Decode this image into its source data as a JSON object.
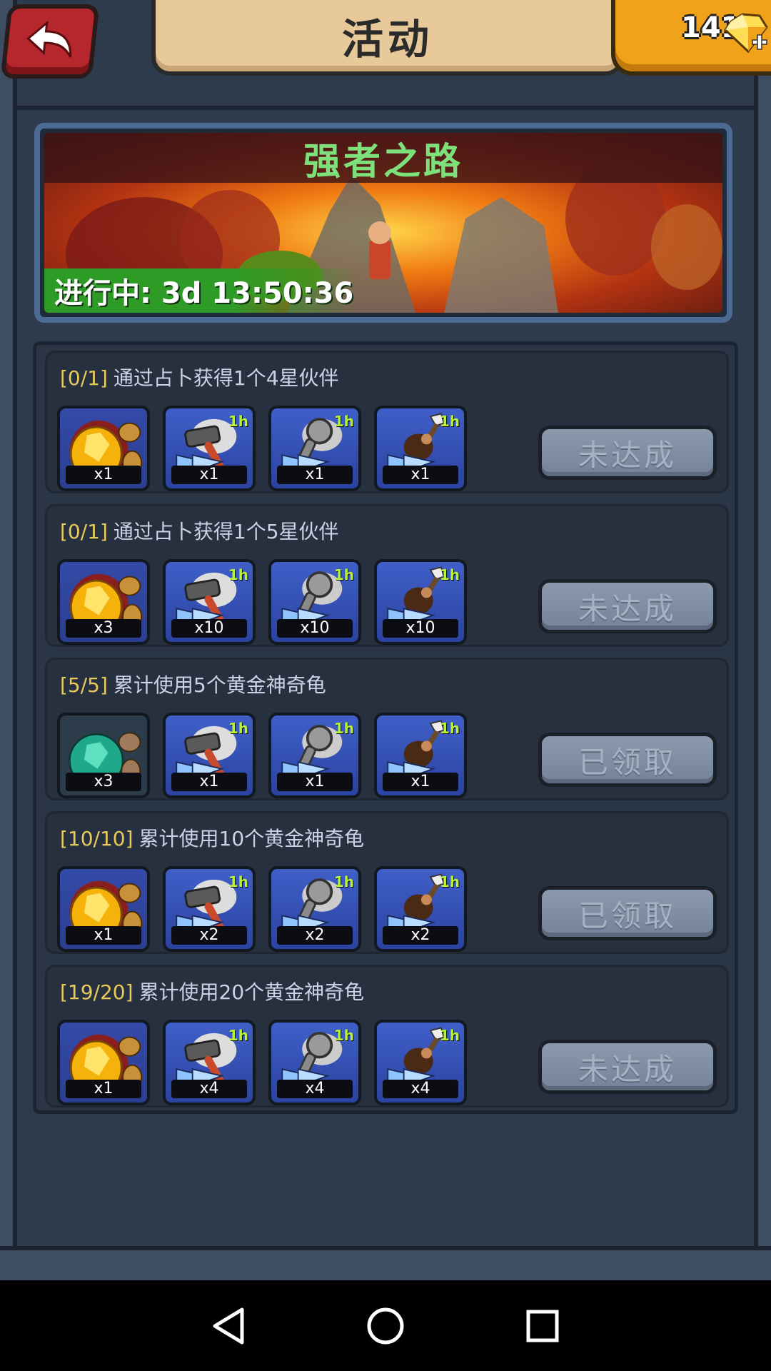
{
  "header": {
    "back_label": "",
    "title": "活动",
    "gems": "141"
  },
  "event": {
    "title": "强者之路",
    "status": "进行中: 3d 13:50:36"
  },
  "tasks": [
    {
      "progress": "[0/1]",
      "description": "通过占卜获得1个4星伙伴",
      "rewards": [
        {
          "icon": "golden-turtle-icon",
          "count": "x1",
          "badge": ""
        },
        {
          "icon": "hammer-speedup-icon",
          "count": "x1",
          "badge": "1h"
        },
        {
          "icon": "magnifier-speedup-icon",
          "count": "x1",
          "badge": "1h"
        },
        {
          "icon": "caveman-speedup-icon",
          "count": "x1",
          "badge": "1h"
        }
      ],
      "button": "未达成"
    },
    {
      "progress": "[0/1]",
      "description": "通过占卜获得1个5星伙伴",
      "rewards": [
        {
          "icon": "golden-turtle-icon",
          "count": "x3",
          "badge": ""
        },
        {
          "icon": "hammer-speedup-icon",
          "count": "x10",
          "badge": "1h"
        },
        {
          "icon": "magnifier-speedup-icon",
          "count": "x10",
          "badge": "1h"
        },
        {
          "icon": "caveman-speedup-icon",
          "count": "x10",
          "badge": "1h"
        }
      ],
      "button": "未达成"
    },
    {
      "progress": "[5/5]",
      "description": "累计使用5个黄金神奇龟",
      "rewards": [
        {
          "icon": "emerald-turtle-icon",
          "count": "x3",
          "badge": ""
        },
        {
          "icon": "hammer-speedup-icon",
          "count": "x1",
          "badge": "1h"
        },
        {
          "icon": "magnifier-speedup-icon",
          "count": "x1",
          "badge": "1h"
        },
        {
          "icon": "caveman-speedup-icon",
          "count": "x1",
          "badge": "1h"
        }
      ],
      "button": "已领取"
    },
    {
      "progress": "[10/10]",
      "description": "累计使用10个黄金神奇龟",
      "rewards": [
        {
          "icon": "golden-turtle-icon",
          "count": "x1",
          "badge": ""
        },
        {
          "icon": "hammer-speedup-icon",
          "count": "x2",
          "badge": "1h"
        },
        {
          "icon": "magnifier-speedup-icon",
          "count": "x2",
          "badge": "1h"
        },
        {
          "icon": "caveman-speedup-icon",
          "count": "x2",
          "badge": "1h"
        }
      ],
      "button": "已领取"
    },
    {
      "progress": "[19/20]",
      "description": "累计使用20个黄金神奇龟",
      "rewards": [
        {
          "icon": "golden-turtle-icon",
          "count": "x1",
          "badge": ""
        },
        {
          "icon": "hammer-speedup-icon",
          "count": "x4",
          "badge": "1h"
        },
        {
          "icon": "magnifier-speedup-icon",
          "count": "x4",
          "badge": "1h"
        },
        {
          "icon": "caveman-speedup-icon",
          "count": "x4",
          "badge": "1h"
        }
      ],
      "button": "未达成"
    }
  ],
  "nav": {
    "back_icon": "triangle-back-icon",
    "home_icon": "circle-home-icon",
    "recents_icon": "square-recents-icon"
  },
  "colors": {
    "accent_green": "#7ee07a",
    "progress_yellow": "#e8c95a",
    "button_gray": "#74839a",
    "back_red": "#b5262d"
  }
}
